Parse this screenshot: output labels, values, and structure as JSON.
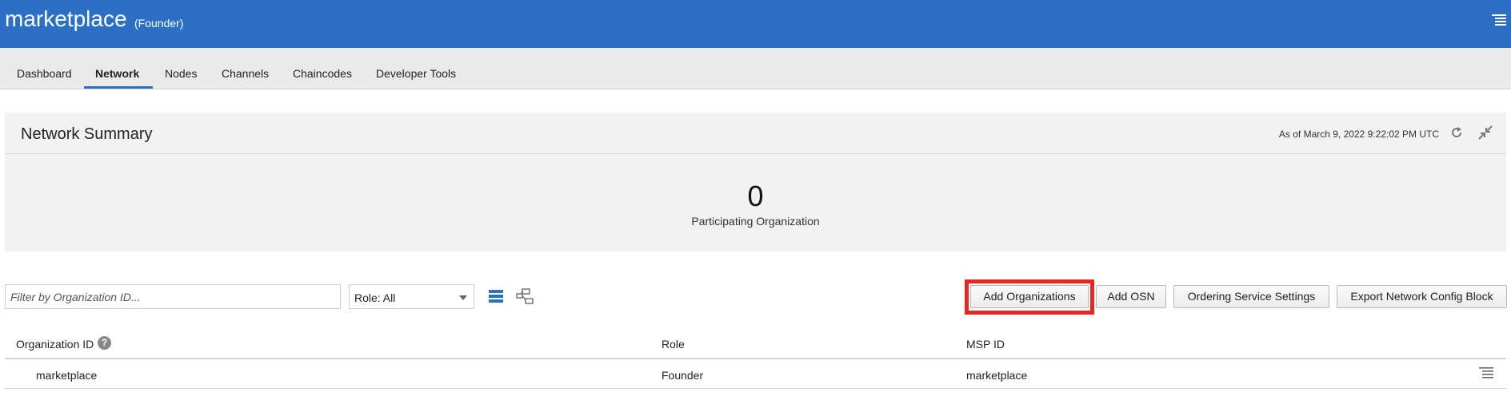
{
  "header": {
    "title": "marketplace",
    "role": "(Founder)",
    "menu_icon": "hamburger-menu-icon",
    "background_color": "#2b70c4"
  },
  "tabs": [
    {
      "label": "Dashboard",
      "active": false
    },
    {
      "label": "Network",
      "active": true
    },
    {
      "label": "Nodes",
      "active": false
    },
    {
      "label": "Channels",
      "active": false
    },
    {
      "label": "Chaincodes",
      "active": false
    },
    {
      "label": "Developer Tools",
      "active": false
    }
  ],
  "summary": {
    "title": "Network Summary",
    "as_of": "As of March 9, 2022 9:22:02 PM UTC",
    "count": "0",
    "count_label": "Participating Organization",
    "refresh_icon": "refresh-icon",
    "collapse_icon": "collapse-icon"
  },
  "toolbar": {
    "filter_placeholder": "Filter by Organization ID...",
    "role_select_value": "Role: All",
    "list_view_icon": "list-view-icon",
    "topology_view_icon": "topology-view-icon",
    "buttons": {
      "add_organizations": "Add Organizations",
      "add_osn": "Add OSN",
      "ordering_service_settings": "Ordering Service Settings",
      "export_network_config_block": "Export Network Config Block"
    },
    "highlight_color": "#e8281e"
  },
  "table": {
    "columns": [
      "Organization ID",
      "Role",
      "MSP ID"
    ],
    "help_icon_glyph": "?",
    "rows": [
      {
        "organization_id": "marketplace",
        "role": "Founder",
        "msp_id": "marketplace"
      }
    ]
  }
}
